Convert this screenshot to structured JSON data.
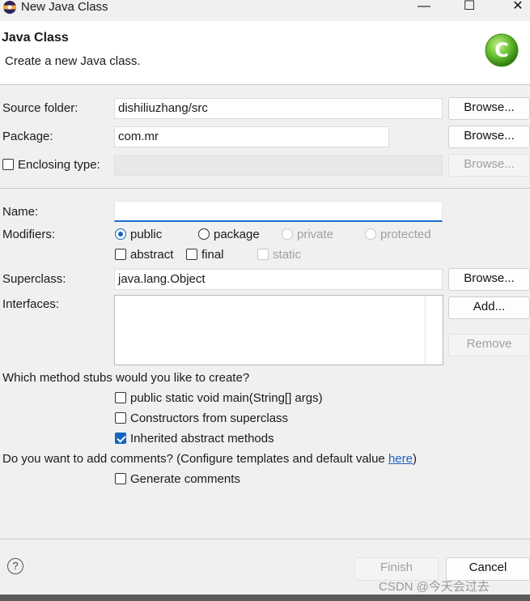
{
  "window": {
    "title": "New Java Class",
    "minimize": "—",
    "maximize": "☐",
    "close": "✕"
  },
  "header": {
    "title": "Java Class",
    "subtitle": "Create a new Java class.",
    "icon": "class-c-icon"
  },
  "form": {
    "source_folder": {
      "label": "Source folder:",
      "value": "dishiliuzhang/src",
      "browse": "Browse..."
    },
    "package": {
      "label": "Package:",
      "value": "com.mr",
      "browse": "Browse..."
    },
    "enclosing": {
      "label": "Enclosing type:",
      "value": "",
      "browse": "Browse...",
      "checked": false
    },
    "name": {
      "label": "Name:",
      "value": ""
    },
    "modifiers": {
      "label": "Modifiers:",
      "access": [
        "public",
        "package",
        "private",
        "protected"
      ],
      "selected": "public",
      "flags": [
        "abstract",
        "final",
        "static"
      ]
    },
    "superclass": {
      "label": "Superclass:",
      "value": "java.lang.Object",
      "browse": "Browse..."
    },
    "interfaces": {
      "label": "Interfaces:",
      "add": "Add...",
      "remove": "Remove"
    },
    "stubs": {
      "question": "Which method stubs would you like to create?",
      "options": [
        "public static void main(String[] args)",
        "Constructors from superclass",
        "Inherited abstract methods"
      ],
      "checked": [
        false,
        false,
        true
      ]
    },
    "comments": {
      "question": "Do you want to add comments? (Configure templates and default value ",
      "link": "here",
      "close_paren": ")",
      "option": "Generate comments",
      "checked": false
    }
  },
  "footer": {
    "help": "?",
    "finish": "Finish",
    "cancel": "Cancel",
    "watermark": "CSDN @今天会过去"
  }
}
